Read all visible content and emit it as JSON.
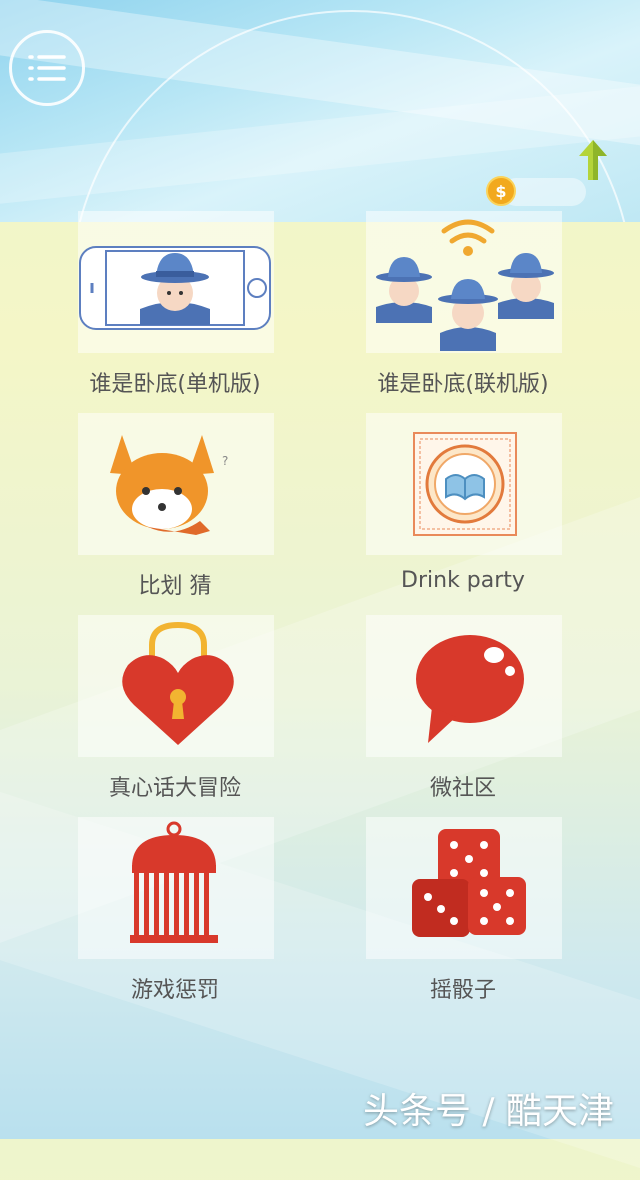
{
  "header": {
    "menu_icon": "list-menu-icon",
    "upgrade_icon": "up-arrow-icon",
    "coin_icon": "coin-icon",
    "coin_symbol": "$",
    "coin_value": ""
  },
  "games": [
    {
      "label": "谁是卧底(单机版)",
      "icon": "spy-phone-icon"
    },
    {
      "label": "谁是卧底(联机版)",
      "icon": "spy-group-wifi-icon"
    },
    {
      "label": "比划 猜",
      "icon": "fox-icon"
    },
    {
      "label": "Drink party",
      "icon": "book-emblem-icon"
    },
    {
      "label": "真心话大冒险",
      "icon": "heart-lock-icon"
    },
    {
      "label": "微社区",
      "icon": "chat-bubble-icon"
    },
    {
      "label": "游戏惩罚",
      "icon": "birdcage-icon"
    },
    {
      "label": "摇骰子",
      "icon": "dice-icon"
    }
  ],
  "watermark": "头条号 / 酷天津",
  "colors": {
    "red": "#d8392b",
    "orange": "#f0952a",
    "blue": "#4c72b4",
    "gold": "#f2a91d"
  }
}
